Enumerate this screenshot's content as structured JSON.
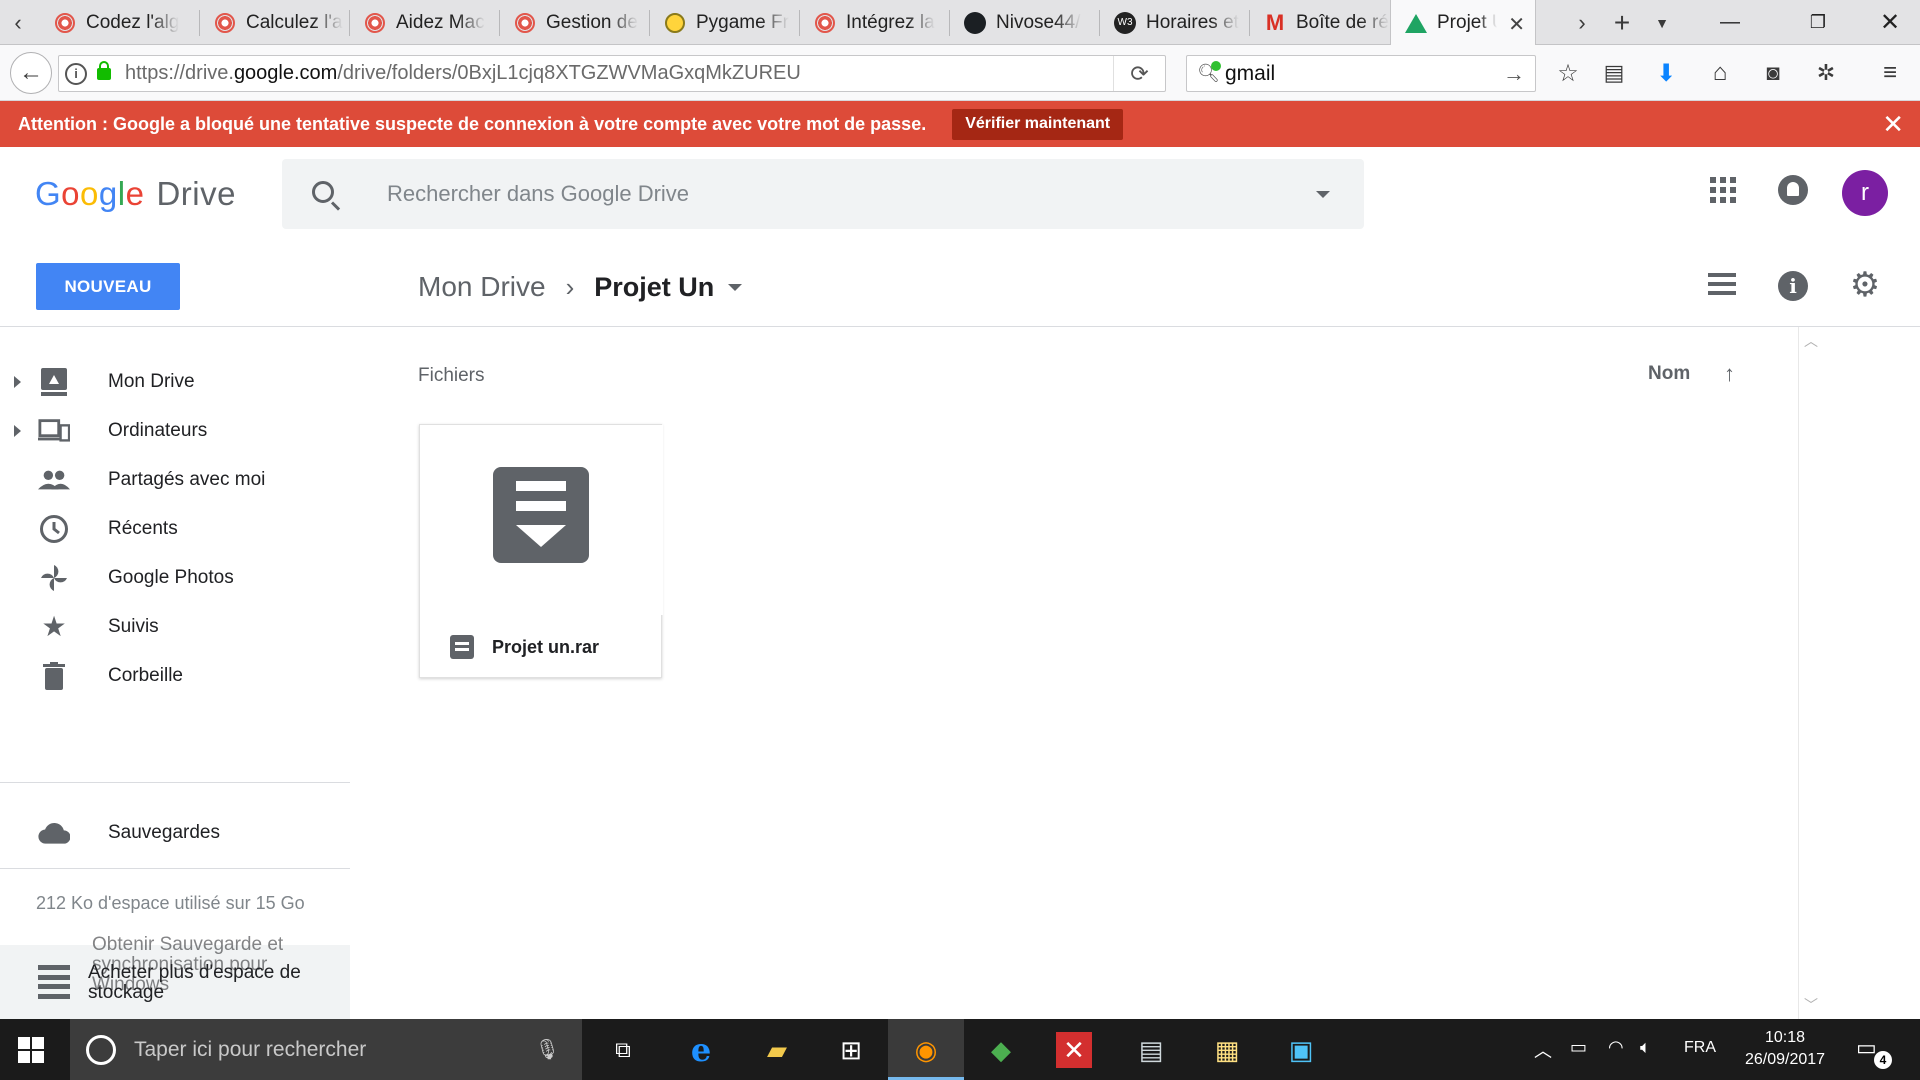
{
  "browser": {
    "tabs": [
      {
        "label": "Codez l'alg",
        "icon": "openclassrooms-icon"
      },
      {
        "label": "Calculez l'a",
        "icon": "openclassrooms-icon"
      },
      {
        "label": "Aidez Mac",
        "icon": "openclassrooms-icon"
      },
      {
        "label": "Gestion de",
        "icon": "openclassrooms-icon"
      },
      {
        "label": "Pygame Fr",
        "icon": "pygame-icon"
      },
      {
        "label": "Intégrez la",
        "icon": "openclassrooms-icon"
      },
      {
        "label": "Nivose44/",
        "icon": "github-icon"
      },
      {
        "label": "Horaires et",
        "icon": "w3c-icon"
      },
      {
        "label": "Boîte de ré",
        "icon": "gmail-icon"
      },
      {
        "label": "Projet U",
        "icon": "google-drive-icon",
        "active": true
      }
    ],
    "url": {
      "prefix": "https://drive.",
      "host": "google.com",
      "path": "/drive/folders/0BxjL1cjq8XTGZWVMaGxqMkZUREU"
    },
    "search_value": "gmail"
  },
  "alert": {
    "message": "Attention : Google a bloqué une tentative suspecte de connexion à votre compte avec votre mot de passe.",
    "action_label": "Vérifier maintenant",
    "color": "#dd4b39"
  },
  "drive": {
    "logo_google": [
      "G",
      "o",
      "o",
      "g",
      "l",
      "e"
    ],
    "logo_product": "Drive",
    "search_placeholder": "Rechercher dans Google Drive",
    "avatar_letter": "r",
    "new_button": "NOUVEAU",
    "breadcrumb": {
      "root": "Mon Drive",
      "current": "Projet Un"
    }
  },
  "sidebar": {
    "items": [
      {
        "label": "Mon Drive",
        "icon": "drive-icon",
        "expandable": true
      },
      {
        "label": "Ordinateurs",
        "icon": "computers-icon",
        "expandable": true
      },
      {
        "label": "Partagés avec moi",
        "icon": "people-icon",
        "expandable": false
      },
      {
        "label": "Récents",
        "icon": "clock-icon",
        "expandable": false
      },
      {
        "label": "Google Photos",
        "icon": "photos-pinwheel-icon",
        "expandable": false
      },
      {
        "label": "Suivis",
        "icon": "star-icon",
        "expandable": false
      },
      {
        "label": "Corbeille",
        "icon": "trash-icon",
        "expandable": false
      }
    ],
    "backups_label": "Sauvegardes",
    "storage_text": "212 Ko d'espace utilisé sur 15 Go",
    "storage_action": "Acheter plus d'espace de stockage",
    "storage_ghost": "Obtenir Sauvegarde et synchronisation pour Windows"
  },
  "main": {
    "section_title": "Fichiers",
    "sort_label": "Nom",
    "files": [
      {
        "name": "Projet un.rar",
        "icon": "archive-file-icon"
      }
    ]
  },
  "taskbar": {
    "search_placeholder": "Taper ici pour rechercher",
    "language": "FRA",
    "time": "10:18",
    "date": "26/09/2017",
    "notifications": "4"
  }
}
